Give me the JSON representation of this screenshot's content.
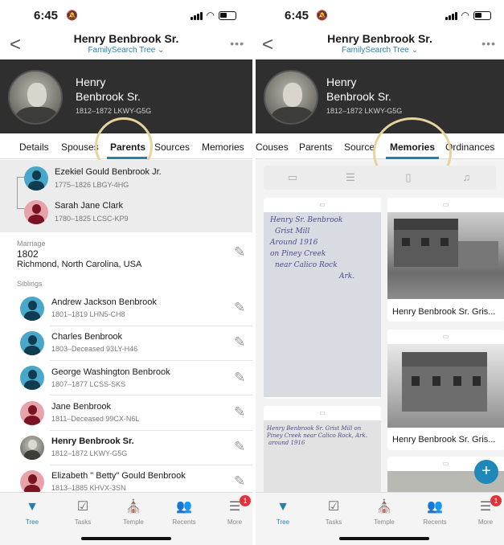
{
  "status": {
    "time_left": "6:45",
    "time_right": "6:45"
  },
  "nav": {
    "back": "<",
    "title": "Henry Benbrook Sr.",
    "subtitle": "FamilySearch Tree ⌄",
    "more": "•••"
  },
  "header": {
    "first": "Henry",
    "last": "Benbrook Sr.",
    "meta": "1812–1872  LKWY-G5G"
  },
  "tabs_left": [
    "Details",
    "Spouses",
    "Parents",
    "Sources",
    "Memories"
  ],
  "tabs_right": [
    "Couses",
    "Parents",
    "Source",
    "Memories",
    "Ordinances"
  ],
  "parents": [
    {
      "name": "Ezekiel Gould Benbrook Jr.",
      "meta": "1775–1826   LBGY-4HG"
    },
    {
      "name": "Sarah Jane Clark",
      "meta": "1780–1825   LCSC-KP9"
    }
  ],
  "marriage": {
    "label": "Marriage",
    "year": "1802",
    "place": "Richmond, North Carolina, USA"
  },
  "siblings_label": "Siblings",
  "siblings": [
    {
      "name": "Andrew Jackson Benbrook",
      "meta": "1801–1819   LHN5-CH8"
    },
    {
      "name": "Charles Benbrook",
      "meta": "1803–Deceased   93LY-H46"
    },
    {
      "name": "George Washington Benbrook",
      "meta": "1807–1877   LCSS-SKS"
    },
    {
      "name": "Jane Benbrook",
      "meta": "1811–Deceased   99CX-N6L"
    },
    {
      "name": "Henry Benbrook Sr.",
      "meta": "1812–1872   LKWY-G5G"
    },
    {
      "name": "Elizabeth \" Betty\" Gould Benbrook",
      "meta": "1813–1885   KHVX-3SN"
    }
  ],
  "tabbar": [
    {
      "label": "Tree",
      "icon": "tree-icon"
    },
    {
      "label": "Tasks",
      "icon": "tasks-icon"
    },
    {
      "label": "Temple",
      "icon": "temple-icon"
    },
    {
      "label": "Recents",
      "icon": "recents-icon"
    },
    {
      "label": "More",
      "icon": "more-icon"
    }
  ],
  "badge": "1",
  "memories": {
    "note1": [
      "Henry Sr. Benbrook",
      "Grist Mill",
      "Around 1916",
      "on Piney Creek",
      "near Calico Rock",
      "Ark."
    ],
    "note2": [
      "Henry Benbrook Sr. Grist Mill on",
      "Piney Creek near Calico Rock, Ark.",
      "around 1916"
    ],
    "caption1": "Henry Benbrook Sr. Gris...",
    "caption2": "Henry Benbrook Sr. Gris...",
    "fab": "+"
  },
  "colors": {
    "accent": "#2a7fa8",
    "highlight_circle": "#e5d49b",
    "header_bg": "#2f2f2f",
    "badge": "#e0323b"
  }
}
